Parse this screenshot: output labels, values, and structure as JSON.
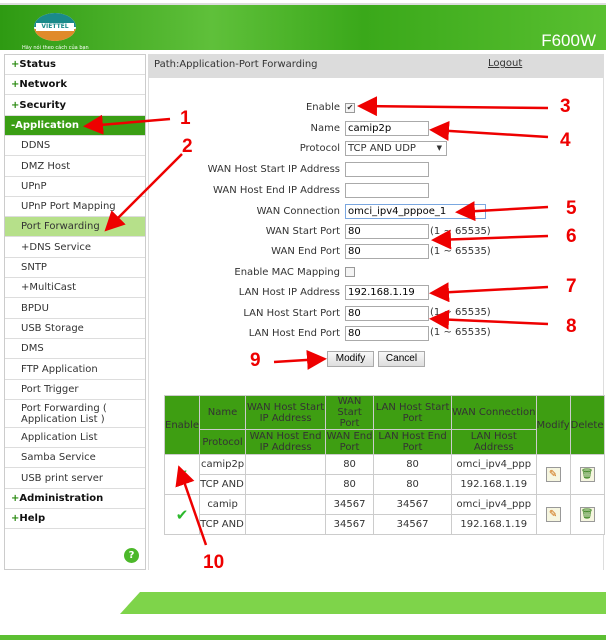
{
  "header": {
    "slogan": "Hãy nói theo cách của bạn",
    "model": "F600W",
    "logo_text": "VIETTEL"
  },
  "path": "Path:Application-Port Forwarding",
  "logout": "Logout",
  "sidebar": {
    "items": [
      {
        "label": "Status",
        "top": true
      },
      {
        "label": "Network",
        "top": true
      },
      {
        "label": "Security",
        "top": true
      },
      {
        "label": "Application",
        "top": true,
        "active": true
      },
      {
        "label": "DDNS"
      },
      {
        "label": "DMZ Host"
      },
      {
        "label": "UPnP"
      },
      {
        "label": "UPnP Port Mapping"
      },
      {
        "label": "Port Forwarding",
        "active": true
      },
      {
        "label": "+DNS Service"
      },
      {
        "label": "SNTP"
      },
      {
        "label": "+MultiCast"
      },
      {
        "label": "BPDU"
      },
      {
        "label": "USB Storage"
      },
      {
        "label": "DMS"
      },
      {
        "label": "FTP Application"
      },
      {
        "label": "Port Trigger"
      },
      {
        "label": "Port Forwarding ( Application List )"
      },
      {
        "label": "Application List"
      },
      {
        "label": "Samba Service"
      },
      {
        "label": "USB print server"
      },
      {
        "label": "Administration",
        "top": true
      },
      {
        "label": "Help",
        "top": true
      }
    ],
    "help_icon": "?"
  },
  "form": {
    "enable_label": "Enable",
    "enable_checked": true,
    "name_label": "Name",
    "name_value": "camip2p",
    "protocol_label": "Protocol",
    "protocol_value": "TCP AND UDP",
    "wan_start_ip_label": "WAN Host Start IP Address",
    "wan_start_ip_value": "",
    "wan_end_ip_label": "WAN Host End IP Address",
    "wan_end_ip_value": "",
    "wan_conn_label": "WAN Connection",
    "wan_conn_value": "omci_ipv4_pppoe_1",
    "wan_start_port_label": "WAN Start Port",
    "wan_start_port_value": "80",
    "wan_end_port_label": "WAN End Port",
    "wan_end_port_value": "80",
    "mac_label": "Enable MAC Mapping",
    "mac_checked": false,
    "lan_ip_label": "LAN Host IP Address",
    "lan_ip_value": "192.168.1.19",
    "lan_start_port_label": "LAN Host Start Port",
    "lan_start_port_value": "80",
    "lan_end_port_label": "LAN Host End Port",
    "lan_end_port_value": "80",
    "range": "(1 ~ 65535)",
    "modify": "Modify",
    "cancel": "Cancel"
  },
  "table": {
    "headers": {
      "enable": "Enable",
      "name": "Name",
      "protocol": "Protocol",
      "wan_start_ip": "WAN Host Start IP Address",
      "wan_end_ip": "WAN Host End IP Address",
      "wan_start_port": "WAN Start Port",
      "wan_end_port": "WAN End Port",
      "lan_start_port": "LAN Host Start Port",
      "lan_end_port": "LAN Host End Port",
      "wan_conn": "WAN Connection",
      "lan_addr": "LAN Host Address",
      "modify": "Modify",
      "delete": "Delete"
    },
    "rows": [
      {
        "name": "camip2p",
        "protocol": "TCP AND UDP",
        "wan_start_ip": "",
        "wan_end_ip": "",
        "wan_start_port": "80",
        "wan_end_port": "80",
        "lan_start_port": "80",
        "lan_end_port": "80",
        "wan_conn": "omci_ipv4_ppp",
        "lan_addr": "192.168.1.19"
      },
      {
        "name": "camip",
        "protocol": "TCP AND UDP",
        "wan_start_ip": "",
        "wan_end_ip": "",
        "wan_start_port": "34567",
        "wan_end_port": "34567",
        "lan_start_port": "34567",
        "lan_end_port": "34567",
        "wan_conn": "omci_ipv4_ppp",
        "lan_addr": "192.168.1.19"
      }
    ]
  },
  "annotations": [
    "1",
    "2",
    "3",
    "4",
    "5",
    "6",
    "7",
    "8",
    "9",
    "10"
  ],
  "colors": {
    "brand_green": "#3a9e14",
    "active_light": "#b6e08a",
    "annotation": "#e00000"
  }
}
